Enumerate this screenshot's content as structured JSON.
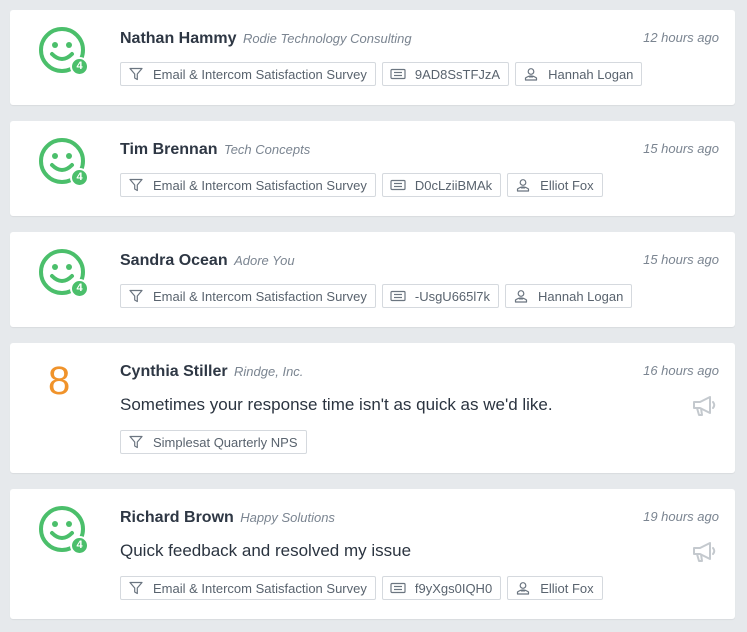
{
  "colors": {
    "accent_green": "#4bbf6b",
    "nps_orange": "#f0932b",
    "background": "#e6e9ec",
    "card": "#ffffff"
  },
  "responses": [
    {
      "rating_icon": "smiley-icon",
      "badge": "4",
      "name": "Nathan Hammy",
      "company": "Rodie Technology Consulting",
      "time": "12 hours ago",
      "survey": "Email & Intercom Satisfaction Survey",
      "ticket": "9AD8SsTFJzA",
      "agent": "Hannah Logan"
    },
    {
      "rating_icon": "smiley-icon",
      "badge": "4",
      "name": "Tim Brennan",
      "company": "Tech Concepts",
      "time": "15 hours ago",
      "survey": "Email & Intercom Satisfaction Survey",
      "ticket": "D0cLziiBMAk",
      "agent": "Elliot Fox"
    },
    {
      "rating_icon": "smiley-icon",
      "badge": "4",
      "name": "Sandra Ocean",
      "company": "Adore You",
      "time": "15 hours ago",
      "survey": "Email & Intercom Satisfaction Survey",
      "ticket": "-UsgU665l7k",
      "agent": "Hannah Logan"
    },
    {
      "score": "8",
      "name": "Cynthia Stiller",
      "company": "Rindge, Inc.",
      "time": "16 hours ago",
      "comment": "Sometimes your response time isn't as quick as we'd like.",
      "survey": "Simplesat Quarterly NPS",
      "action_icon": "megaphone-icon"
    },
    {
      "rating_icon": "smiley-icon",
      "badge": "4",
      "name": "Richard Brown",
      "company": "Happy Solutions",
      "time": "19 hours ago",
      "comment": "Quick feedback and resolved my issue",
      "survey": "Email & Intercom Satisfaction Survey",
      "ticket": "f9yXgs0IQH0",
      "agent": "Elliot Fox",
      "action_icon": "megaphone-icon"
    }
  ]
}
